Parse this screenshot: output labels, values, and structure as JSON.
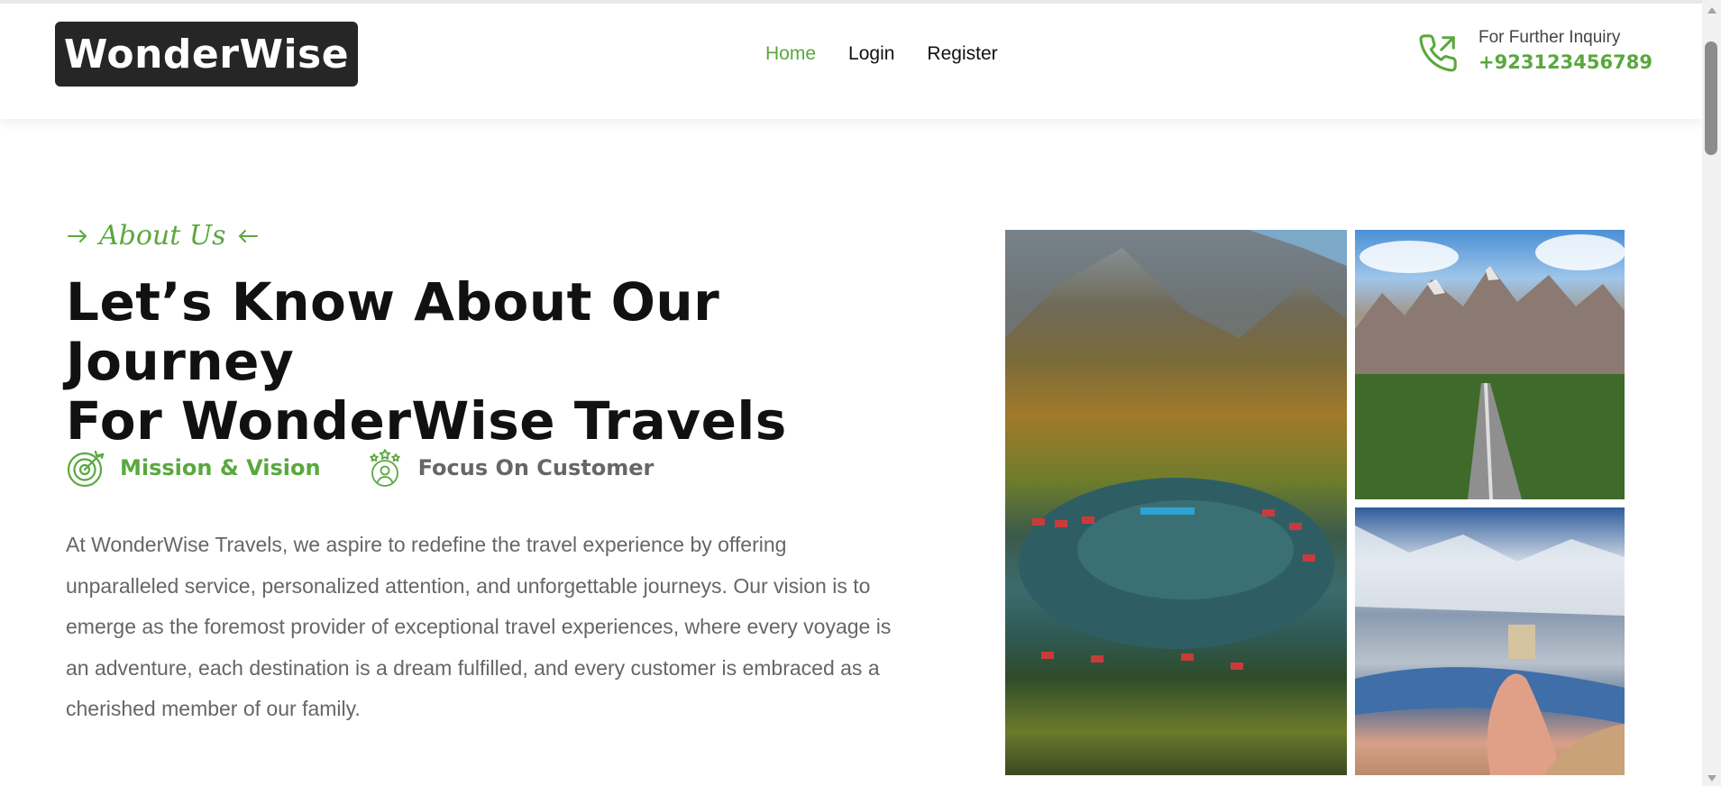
{
  "header": {
    "logo_text": "WonderWise",
    "nav": [
      {
        "label": "Home",
        "active": true
      },
      {
        "label": "Login",
        "active": false
      },
      {
        "label": "Register",
        "active": false
      }
    ],
    "contact": {
      "icon": "phone-outgoing-icon",
      "label": "For Further Inquiry",
      "phone": "+923123456789"
    }
  },
  "about": {
    "tag": "About Us",
    "title_line1": "Let’s Know About Our Journey",
    "title_line2": "For WonderWise Travels",
    "features": [
      {
        "label": "Mission & Vision",
        "icon": "target-icon",
        "active": true
      },
      {
        "label": "Focus On Customer",
        "icon": "customer-stars-icon",
        "active": false
      }
    ],
    "description": "At WonderWise Travels, we aspire to redefine the travel experience by offering unparalleled service, personalized attention, and unforgettable journeys. Our vision is to emerge as the foremost provider of exceptional travel experiences, where every voyage is an adventure, each destination is a dream fulfilled, and every customer is embraced as a cherished member of our family."
  },
  "gallery": [
    {
      "name": "lake-valley-photo"
    },
    {
      "name": "mountain-road-photo"
    },
    {
      "name": "hand-snow-valley-photo"
    }
  ],
  "colors": {
    "accent": "#5aa83e",
    "logo_bg": "#262626",
    "heading": "#111111",
    "body_text": "#666666"
  }
}
